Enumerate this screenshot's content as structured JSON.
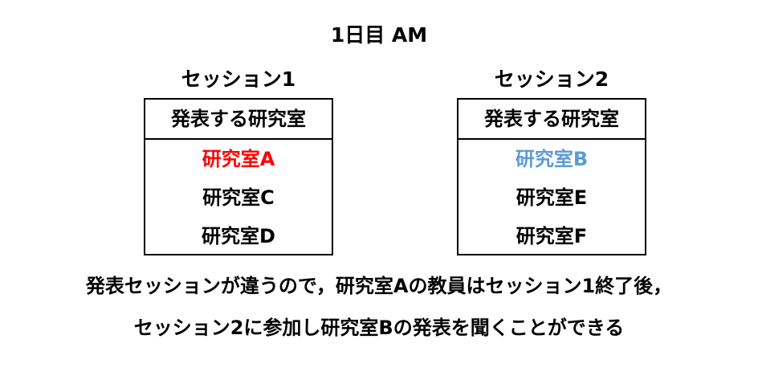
{
  "title": "1日目 AM",
  "sessions": [
    {
      "heading": "セッション1",
      "table_header": "発表する研究室",
      "labs": [
        {
          "name": "研究室A",
          "color": "#ff0000"
        },
        {
          "name": "研究室C",
          "color": "#000000"
        },
        {
          "name": "研究室D",
          "color": "#000000"
        }
      ]
    },
    {
      "heading": "セッション2",
      "table_header": "発表する研究室",
      "labs": [
        {
          "name": "研究室B",
          "color": "#5b9bd5"
        },
        {
          "name": "研究室E",
          "color": "#000000"
        },
        {
          "name": "研究室F",
          "color": "#000000"
        }
      ]
    }
  ],
  "caption": {
    "line1": "発表セッションが違うので，研究室Aの教員はセッション1終了後，",
    "line2": "セッション2に参加し研究室Bの発表を聞くことができる"
  }
}
